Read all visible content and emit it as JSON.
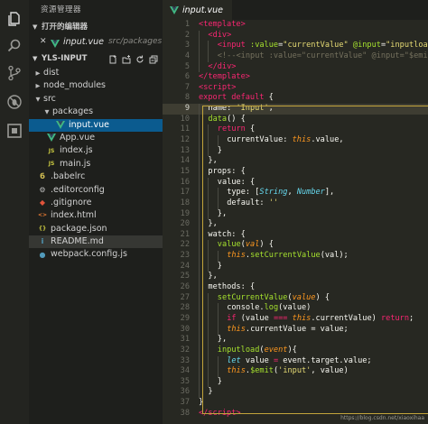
{
  "sidebar": {
    "title": "资源管理器",
    "open_editors_label": "打开的编辑器",
    "open_editor": {
      "close": "✕",
      "name": "input.vue",
      "path": "src/packages"
    },
    "project_name": "YLS-INPUT",
    "tree": [
      {
        "label": "dist",
        "kind": "folder",
        "expanded": false,
        "indent": 0
      },
      {
        "label": "node_modules",
        "kind": "folder",
        "expanded": false,
        "indent": 0
      },
      {
        "label": "src",
        "kind": "folder",
        "expanded": true,
        "indent": 0
      },
      {
        "label": "packages",
        "kind": "folder",
        "expanded": true,
        "indent": 1
      },
      {
        "label": "input.vue",
        "kind": "vue",
        "indent": 2,
        "active": true
      },
      {
        "label": "App.vue",
        "kind": "vue",
        "indent": 1
      },
      {
        "label": "index.js",
        "kind": "js",
        "indent": 1
      },
      {
        "label": "main.js",
        "kind": "js",
        "indent": 1
      },
      {
        "label": ".babelrc",
        "kind": "babel",
        "indent": 0
      },
      {
        "label": ".editorconfig",
        "kind": "config",
        "indent": 0
      },
      {
        "label": ".gitignore",
        "kind": "git",
        "indent": 0
      },
      {
        "label": "index.html",
        "kind": "html",
        "indent": 0
      },
      {
        "label": "package.json",
        "kind": "json",
        "indent": 0
      },
      {
        "label": "README.md",
        "kind": "info",
        "indent": 0,
        "hover": true
      },
      {
        "label": "webpack.config.js",
        "kind": "webpack",
        "indent": 0
      }
    ]
  },
  "editor": {
    "tab_label": "input.vue",
    "current_line": 9,
    "watermark": "https://blog.csdn.net/xiaoxihaa",
    "lines": [
      {
        "n": "1",
        "g": 0,
        "s": [
          [
            "<",
            "tag"
          ],
          [
            "template",
            "tag"
          ],
          [
            ">",
            "tag"
          ]
        ]
      },
      {
        "n": "2",
        "g": 1,
        "s": [
          [
            "<",
            "tag"
          ],
          [
            "div",
            "tag"
          ],
          [
            ">",
            "tag"
          ]
        ]
      },
      {
        "n": "3",
        "g": 2,
        "s": [
          [
            "<",
            "tag"
          ],
          [
            "input ",
            "tag"
          ],
          [
            ":value",
            "attr"
          ],
          [
            "=",
            "y"
          ],
          [
            "\"currentValue\"",
            "str"
          ],
          [
            " ",
            "y"
          ],
          [
            "@input",
            "attr"
          ],
          [
            "=",
            "y"
          ],
          [
            "\"inputload\"",
            "str"
          ],
          [
            ">",
            "tag"
          ]
        ]
      },
      {
        "n": "4",
        "g": 2,
        "s": [
          [
            "<!--<input :value=\"currentValue\" @input=\"$emit('i",
            "com"
          ]
        ]
      },
      {
        "n": "5",
        "g": 1,
        "s": [
          [
            "</",
            "tag"
          ],
          [
            "div",
            "tag"
          ],
          [
            ">",
            "tag"
          ]
        ]
      },
      {
        "n": "6",
        "g": 0,
        "s": [
          [
            "</",
            "tag"
          ],
          [
            "template",
            "tag"
          ],
          [
            ">",
            "tag"
          ]
        ]
      },
      {
        "n": "7",
        "g": 0,
        "s": [
          [
            "<",
            "tag"
          ],
          [
            "script",
            "tag"
          ],
          [
            ">",
            "tag"
          ]
        ]
      },
      {
        "n": "8",
        "g": 0,
        "s": [
          [
            "export ",
            "kw"
          ],
          [
            "default ",
            "kw"
          ],
          [
            "{",
            "y"
          ]
        ]
      },
      {
        "n": "9",
        "g": 1,
        "s": [
          [
            "name: ",
            "y"
          ],
          [
            "'Input'",
            "str"
          ],
          [
            ",",
            "y"
          ]
        ]
      },
      {
        "n": "10",
        "g": 1,
        "s": [
          [
            "data",
            "fn"
          ],
          [
            "() {",
            "y"
          ]
        ]
      },
      {
        "n": "11",
        "g": 2,
        "s": [
          [
            "return ",
            "kw"
          ],
          [
            "{",
            "y"
          ]
        ]
      },
      {
        "n": "12",
        "g": 3,
        "s": [
          [
            "currentValue: ",
            "y"
          ],
          [
            "this",
            "this"
          ],
          [
            ".value,",
            "y"
          ]
        ]
      },
      {
        "n": "13",
        "g": 2,
        "s": [
          [
            "}",
            "y"
          ]
        ]
      },
      {
        "n": "14",
        "g": 1,
        "s": [
          [
            "},",
            "y"
          ]
        ]
      },
      {
        "n": "15",
        "g": 1,
        "s": [
          [
            "props: {",
            "y"
          ]
        ]
      },
      {
        "n": "16",
        "g": 2,
        "s": [
          [
            "value: {",
            "y"
          ]
        ]
      },
      {
        "n": "17",
        "g": 3,
        "s": [
          [
            "type: [",
            "y"
          ],
          [
            "String",
            "type"
          ],
          [
            ", ",
            "y"
          ],
          [
            "Number",
            "type"
          ],
          [
            "],",
            "y"
          ]
        ]
      },
      {
        "n": "18",
        "g": 3,
        "s": [
          [
            "default: ",
            "y"
          ],
          [
            "''",
            "str"
          ]
        ]
      },
      {
        "n": "19",
        "g": 2,
        "s": [
          [
            "},",
            "y"
          ]
        ]
      },
      {
        "n": "20",
        "g": 1,
        "s": [
          [
            "},",
            "y"
          ]
        ]
      },
      {
        "n": "21",
        "g": 1,
        "s": [
          [
            "watch: {",
            "y"
          ]
        ]
      },
      {
        "n": "22",
        "g": 2,
        "s": [
          [
            "value",
            "fn"
          ],
          [
            "(",
            "y"
          ],
          [
            "val",
            "par"
          ],
          [
            ") {",
            "y"
          ]
        ]
      },
      {
        "n": "23",
        "g": 3,
        "s": [
          [
            "this",
            "this"
          ],
          [
            ".",
            "y"
          ],
          [
            "setCurrentValue",
            "fn"
          ],
          [
            "(val);",
            "y"
          ]
        ]
      },
      {
        "n": "24",
        "g": 2,
        "s": [
          [
            "}",
            "y"
          ]
        ]
      },
      {
        "n": "25",
        "g": 1,
        "s": [
          [
            "},",
            "y"
          ]
        ]
      },
      {
        "n": "26",
        "g": 1,
        "s": [
          [
            "methods: {",
            "y"
          ]
        ]
      },
      {
        "n": "27",
        "g": 2,
        "s": [
          [
            "setCurrentValue",
            "fn"
          ],
          [
            "(",
            "y"
          ],
          [
            "value",
            "par"
          ],
          [
            ") {",
            "y"
          ]
        ]
      },
      {
        "n": "28",
        "g": 3,
        "s": [
          [
            "console.",
            "y"
          ],
          [
            "log",
            "fn"
          ],
          [
            "(value)",
            "y"
          ]
        ]
      },
      {
        "n": "29",
        "g": 3,
        "s": [
          [
            "if ",
            "kw"
          ],
          [
            "(value ",
            "y"
          ],
          [
            "===",
            "kw"
          ],
          [
            " ",
            "y"
          ],
          [
            "this",
            "this"
          ],
          [
            ".currentValue) ",
            "y"
          ],
          [
            "return",
            "kw"
          ],
          [
            ";",
            "y"
          ]
        ]
      },
      {
        "n": "30",
        "g": 3,
        "s": [
          [
            "this",
            "this"
          ],
          [
            ".currentValue = value;",
            "y"
          ]
        ]
      },
      {
        "n": "31",
        "g": 2,
        "s": [
          [
            "},",
            "y"
          ]
        ]
      },
      {
        "n": "32",
        "g": 2,
        "s": [
          [
            "inputload",
            "fn"
          ],
          [
            "(",
            "y"
          ],
          [
            "event",
            "par"
          ],
          [
            "){",
            "y"
          ]
        ]
      },
      {
        "n": "33",
        "g": 3,
        "s": [
          [
            "let ",
            "type"
          ],
          [
            "value ",
            "y"
          ],
          [
            "=",
            "kw"
          ],
          [
            " event.target.value;",
            "y"
          ]
        ]
      },
      {
        "n": "34",
        "g": 3,
        "s": [
          [
            "this",
            "this"
          ],
          [
            ".",
            "y"
          ],
          [
            "$emit",
            "fn"
          ],
          [
            "(",
            "y"
          ],
          [
            "'input'",
            "str"
          ],
          [
            ", value)",
            "y"
          ]
        ]
      },
      {
        "n": "35",
        "g": 2,
        "s": [
          [
            "}",
            "y"
          ]
        ]
      },
      {
        "n": "36",
        "g": 1,
        "s": [
          [
            "}",
            "y"
          ]
        ]
      },
      {
        "n": "37",
        "g": 0,
        "s": [
          [
            "}",
            "y"
          ]
        ]
      },
      {
        "n": "38",
        "g": 0,
        "s": [
          [
            "</",
            "tag"
          ],
          [
            "script",
            "tag"
          ],
          [
            ">",
            "tag"
          ]
        ]
      }
    ]
  },
  "colors": {
    "accent": "#0b5b8f",
    "vue_green": "#41b883",
    "highlight_box": "#c2a43b"
  }
}
